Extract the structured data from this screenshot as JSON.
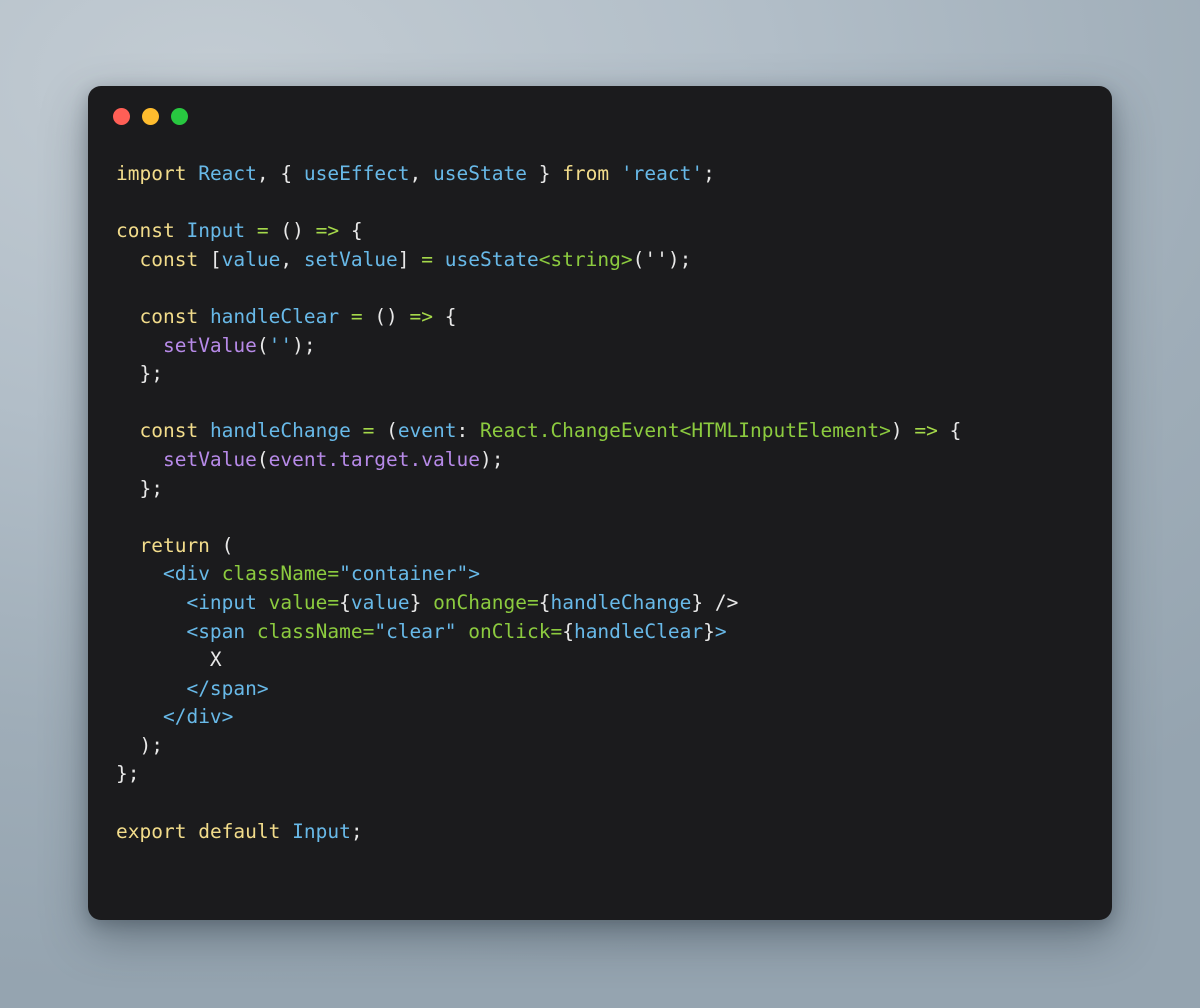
{
  "window": {
    "title": "",
    "background_color": "#1b1b1d",
    "traffic_lights": [
      {
        "name": "close",
        "color": "#ff5f56"
      },
      {
        "name": "minimize",
        "color": "#febc2e"
      },
      {
        "name": "maximize",
        "color": "#28c840"
      }
    ]
  },
  "theme": {
    "page_background": "#aebac4",
    "keyword": "#f2dc8b",
    "identifier": "#68b9e8",
    "punctuation": "#e8e8e8",
    "operator": "#a5d94a",
    "type": "#8ccb3f",
    "function_call": "#b78ae8",
    "string": "#68b9e8",
    "language": "tsx"
  },
  "code": {
    "language": "tsx",
    "plain_text": "import React, { useEffect, useState } from 'react';\n\nconst Input = () => {\n  const [value, setValue] = useState<string>('');\n\n  const handleClear = () => {\n    setValue('');\n  };\n\n  const handleChange = (event: React.ChangeEvent<HTMLInputElement>) => {\n    setValue(event.target.value);\n  };\n\n  return (\n    <div className=\"container\">\n      <input value={value} onChange={handleChange} />\n      <span className=\"clear\" onClick={handleClear}>\n        X\n      </span>\n    </div>\n  );\n};\n\nexport default Input;",
    "lines": [
      {
        "n": 1,
        "tokens": [
          {
            "t": "import",
            "c": "kw"
          },
          {
            "t": " ",
            "c": "punc"
          },
          {
            "t": "React",
            "c": "ident"
          },
          {
            "t": ", ",
            "c": "punc"
          },
          {
            "t": "{ ",
            "c": "punc"
          },
          {
            "t": "useEffect",
            "c": "ident"
          },
          {
            "t": ", ",
            "c": "punc"
          },
          {
            "t": "useState",
            "c": "ident"
          },
          {
            "t": " } ",
            "c": "punc"
          },
          {
            "t": "from",
            "c": "kw"
          },
          {
            "t": " ",
            "c": "punc"
          },
          {
            "t": "'react'",
            "c": "str"
          },
          {
            "t": ";",
            "c": "punc"
          }
        ]
      },
      {
        "n": 2,
        "tokens": []
      },
      {
        "n": 3,
        "tokens": [
          {
            "t": "const",
            "c": "kw"
          },
          {
            "t": " ",
            "c": "punc"
          },
          {
            "t": "Input",
            "c": "ident"
          },
          {
            "t": " ",
            "c": "punc"
          },
          {
            "t": "=",
            "c": "op"
          },
          {
            "t": " () ",
            "c": "punc"
          },
          {
            "t": "=>",
            "c": "op"
          },
          {
            "t": " {",
            "c": "punc"
          }
        ]
      },
      {
        "n": 4,
        "tokens": [
          {
            "t": "  ",
            "c": "punc"
          },
          {
            "t": "const",
            "c": "kw"
          },
          {
            "t": " [",
            "c": "punc"
          },
          {
            "t": "value",
            "c": "ident"
          },
          {
            "t": ", ",
            "c": "punc"
          },
          {
            "t": "setValue",
            "c": "ident"
          },
          {
            "t": "] ",
            "c": "punc"
          },
          {
            "t": "=",
            "c": "op"
          },
          {
            "t": " ",
            "c": "punc"
          },
          {
            "t": "useState",
            "c": "ident"
          },
          {
            "t": "<string>",
            "c": "type"
          },
          {
            "t": "(",
            "c": "punc"
          },
          {
            "t": "''",
            "c": "punc"
          },
          {
            "t": ");",
            "c": "punc"
          }
        ]
      },
      {
        "n": 5,
        "tokens": []
      },
      {
        "n": 6,
        "tokens": [
          {
            "t": "  ",
            "c": "punc"
          },
          {
            "t": "const",
            "c": "kw"
          },
          {
            "t": " ",
            "c": "punc"
          },
          {
            "t": "handleClear",
            "c": "ident"
          },
          {
            "t": " ",
            "c": "punc"
          },
          {
            "t": "=",
            "c": "op"
          },
          {
            "t": " () ",
            "c": "punc"
          },
          {
            "t": "=>",
            "c": "op"
          },
          {
            "t": " {",
            "c": "punc"
          }
        ]
      },
      {
        "n": 7,
        "tokens": [
          {
            "t": "    ",
            "c": "punc"
          },
          {
            "t": "setValue",
            "c": "fn"
          },
          {
            "t": "(",
            "c": "punc"
          },
          {
            "t": "''",
            "c": "str"
          },
          {
            "t": ");",
            "c": "punc"
          }
        ]
      },
      {
        "n": 8,
        "tokens": [
          {
            "t": "  };",
            "c": "punc"
          }
        ]
      },
      {
        "n": 9,
        "tokens": []
      },
      {
        "n": 10,
        "tokens": [
          {
            "t": "  ",
            "c": "punc"
          },
          {
            "t": "const",
            "c": "kw"
          },
          {
            "t": " ",
            "c": "punc"
          },
          {
            "t": "handleChange",
            "c": "ident"
          },
          {
            "t": " ",
            "c": "punc"
          },
          {
            "t": "=",
            "c": "op"
          },
          {
            "t": " (",
            "c": "punc"
          },
          {
            "t": "event",
            "c": "ident"
          },
          {
            "t": ": ",
            "c": "punc"
          },
          {
            "t": "React.ChangeEvent<HTMLInputElement>",
            "c": "type"
          },
          {
            "t": ") ",
            "c": "punc"
          },
          {
            "t": "=>",
            "c": "op"
          },
          {
            "t": " {",
            "c": "punc"
          }
        ]
      },
      {
        "n": 11,
        "tokens": [
          {
            "t": "    ",
            "c": "punc"
          },
          {
            "t": "setValue",
            "c": "fn"
          },
          {
            "t": "(",
            "c": "punc"
          },
          {
            "t": "event.target.value",
            "c": "fn"
          },
          {
            "t": ");",
            "c": "punc"
          }
        ]
      },
      {
        "n": 12,
        "tokens": [
          {
            "t": "  };",
            "c": "punc"
          }
        ]
      },
      {
        "n": 13,
        "tokens": []
      },
      {
        "n": 14,
        "tokens": [
          {
            "t": "  ",
            "c": "punc"
          },
          {
            "t": "return",
            "c": "kw"
          },
          {
            "t": " (",
            "c": "punc"
          }
        ]
      },
      {
        "n": 15,
        "tokens": [
          {
            "t": "    ",
            "c": "punc"
          },
          {
            "t": "<div",
            "c": "ident"
          },
          {
            "t": " ",
            "c": "punc"
          },
          {
            "t": "className",
            "c": "type"
          },
          {
            "t": "=",
            "c": "type"
          },
          {
            "t": "\"container\"",
            "c": "str"
          },
          {
            "t": ">",
            "c": "ident"
          }
        ]
      },
      {
        "n": 16,
        "tokens": [
          {
            "t": "      ",
            "c": "punc"
          },
          {
            "t": "<input",
            "c": "ident"
          },
          {
            "t": " ",
            "c": "punc"
          },
          {
            "t": "value",
            "c": "type"
          },
          {
            "t": "=",
            "c": "type"
          },
          {
            "t": "{",
            "c": "punc"
          },
          {
            "t": "value",
            "c": "ident"
          },
          {
            "t": "}",
            "c": "punc"
          },
          {
            "t": " ",
            "c": "punc"
          },
          {
            "t": "onChange",
            "c": "type"
          },
          {
            "t": "=",
            "c": "type"
          },
          {
            "t": "{",
            "c": "punc"
          },
          {
            "t": "handleChange",
            "c": "ident"
          },
          {
            "t": "}",
            "c": "punc"
          },
          {
            "t": " />",
            "c": "punc"
          }
        ]
      },
      {
        "n": 17,
        "tokens": [
          {
            "t": "      ",
            "c": "punc"
          },
          {
            "t": "<span",
            "c": "ident"
          },
          {
            "t": " ",
            "c": "punc"
          },
          {
            "t": "className",
            "c": "type"
          },
          {
            "t": "=",
            "c": "type"
          },
          {
            "t": "\"clear\"",
            "c": "str"
          },
          {
            "t": " ",
            "c": "punc"
          },
          {
            "t": "onClick",
            "c": "type"
          },
          {
            "t": "=",
            "c": "type"
          },
          {
            "t": "{",
            "c": "punc"
          },
          {
            "t": "handleClear",
            "c": "ident"
          },
          {
            "t": "}",
            "c": "punc"
          },
          {
            "t": ">",
            "c": "ident"
          }
        ]
      },
      {
        "n": 18,
        "tokens": [
          {
            "t": "        ",
            "c": "punc"
          },
          {
            "t": "X",
            "c": "plain"
          }
        ]
      },
      {
        "n": 19,
        "tokens": [
          {
            "t": "      ",
            "c": "punc"
          },
          {
            "t": "</span>",
            "c": "ident"
          }
        ]
      },
      {
        "n": 20,
        "tokens": [
          {
            "t": "    ",
            "c": "punc"
          },
          {
            "t": "</div>",
            "c": "ident"
          }
        ]
      },
      {
        "n": 21,
        "tokens": [
          {
            "t": "  );",
            "c": "punc"
          }
        ]
      },
      {
        "n": 22,
        "tokens": [
          {
            "t": "};",
            "c": "punc"
          }
        ]
      },
      {
        "n": 23,
        "tokens": []
      },
      {
        "n": 24,
        "tokens": [
          {
            "t": "export",
            "c": "kw"
          },
          {
            "t": " ",
            "c": "punc"
          },
          {
            "t": "default",
            "c": "kw"
          },
          {
            "t": " ",
            "c": "punc"
          },
          {
            "t": "Input",
            "c": "ident"
          },
          {
            "t": ";",
            "c": "punc"
          }
        ]
      }
    ]
  }
}
